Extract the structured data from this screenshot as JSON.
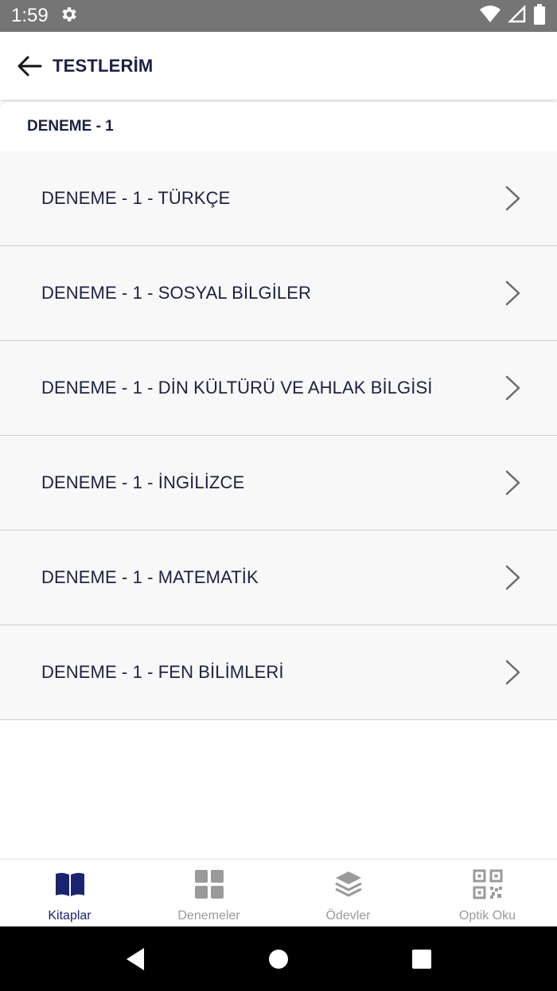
{
  "status_bar": {
    "time": "1:59"
  },
  "app_bar": {
    "title": "TESTLERİM"
  },
  "section": {
    "header": "DENEME - 1",
    "items": [
      {
        "label": "DENEME - 1 - TÜRKÇE"
      },
      {
        "label": "DENEME - 1 - SOSYAL BİLGİLER"
      },
      {
        "label": "DENEME - 1 - DİN KÜLTÜRÜ VE AHLAK BİLGİSİ"
      },
      {
        "label": "DENEME - 1 - İNGİLİZCE"
      },
      {
        "label": "DENEME - 1 - MATEMATİK"
      },
      {
        "label": "DENEME - 1 - FEN BİLİMLERİ"
      }
    ]
  },
  "bottom_nav": {
    "items": [
      {
        "label": "Kitaplar",
        "icon": "book-icon",
        "active": true
      },
      {
        "label": "Denemeler",
        "icon": "grid-icon",
        "active": false
      },
      {
        "label": "Ödevler",
        "icon": "layers-icon",
        "active": false
      },
      {
        "label": "Optik Oku",
        "icon": "qr-code-icon",
        "active": false
      }
    ]
  },
  "colors": {
    "primary_text": "#1b2142",
    "active_nav": "#1b2470",
    "inactive_nav": "#9a9a9a",
    "status_bar": "#757575",
    "list_background": "#f8f8f8"
  }
}
